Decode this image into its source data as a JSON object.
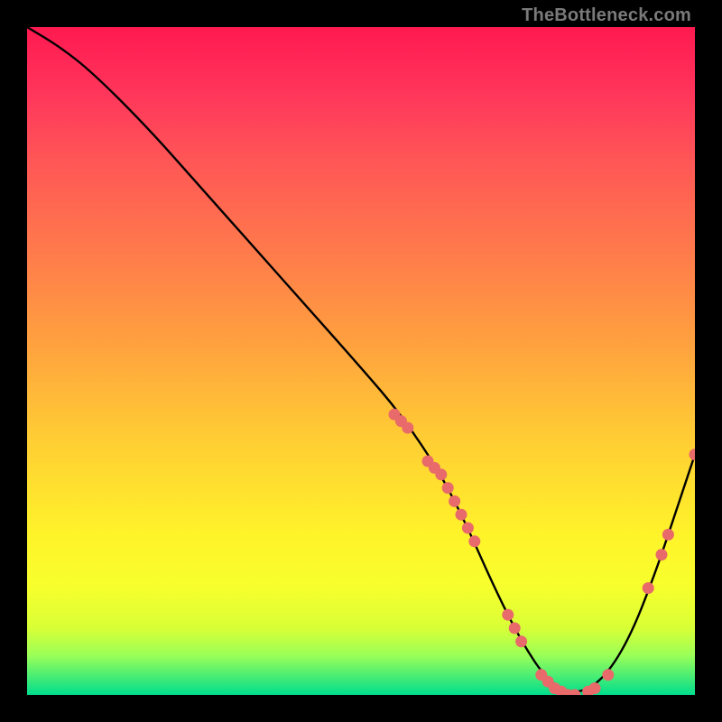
{
  "watermark": "TheBottleneck.com",
  "chart_data": {
    "type": "line",
    "title": "",
    "xlabel": "",
    "ylabel": "",
    "xlim": [
      0,
      100
    ],
    "ylim": [
      0,
      100
    ],
    "grid": false,
    "legend": false,
    "curve": {
      "name": "bottleneck-curve",
      "x": [
        0,
        5,
        10,
        18,
        26,
        34,
        42,
        50,
        56,
        62,
        66,
        70,
        74,
        78,
        82,
        86,
        90,
        94,
        98,
        100
      ],
      "y": [
        100,
        97,
        93,
        85,
        76,
        67,
        58,
        49,
        42,
        33,
        25,
        16,
        8,
        2,
        0,
        2,
        8,
        18,
        30,
        36
      ]
    },
    "markers": {
      "name": "data-points",
      "color": "#e86a6a",
      "points": [
        {
          "x": 55,
          "y": 42
        },
        {
          "x": 56,
          "y": 41
        },
        {
          "x": 57,
          "y": 40
        },
        {
          "x": 60,
          "y": 35
        },
        {
          "x": 61,
          "y": 34
        },
        {
          "x": 62,
          "y": 33
        },
        {
          "x": 63,
          "y": 31
        },
        {
          "x": 64,
          "y": 29
        },
        {
          "x": 65,
          "y": 27
        },
        {
          "x": 66,
          "y": 25
        },
        {
          "x": 67,
          "y": 23
        },
        {
          "x": 72,
          "y": 12
        },
        {
          "x": 73,
          "y": 10
        },
        {
          "x": 74,
          "y": 8
        },
        {
          "x": 77,
          "y": 3
        },
        {
          "x": 78,
          "y": 2
        },
        {
          "x": 79,
          "y": 1
        },
        {
          "x": 80,
          "y": 0.5
        },
        {
          "x": 81,
          "y": 0
        },
        {
          "x": 82,
          "y": 0
        },
        {
          "x": 84,
          "y": 0.5
        },
        {
          "x": 85,
          "y": 1
        },
        {
          "x": 87,
          "y": 3
        },
        {
          "x": 93,
          "y": 16
        },
        {
          "x": 95,
          "y": 21
        },
        {
          "x": 96,
          "y": 24
        },
        {
          "x": 100,
          "y": 36
        }
      ]
    }
  }
}
